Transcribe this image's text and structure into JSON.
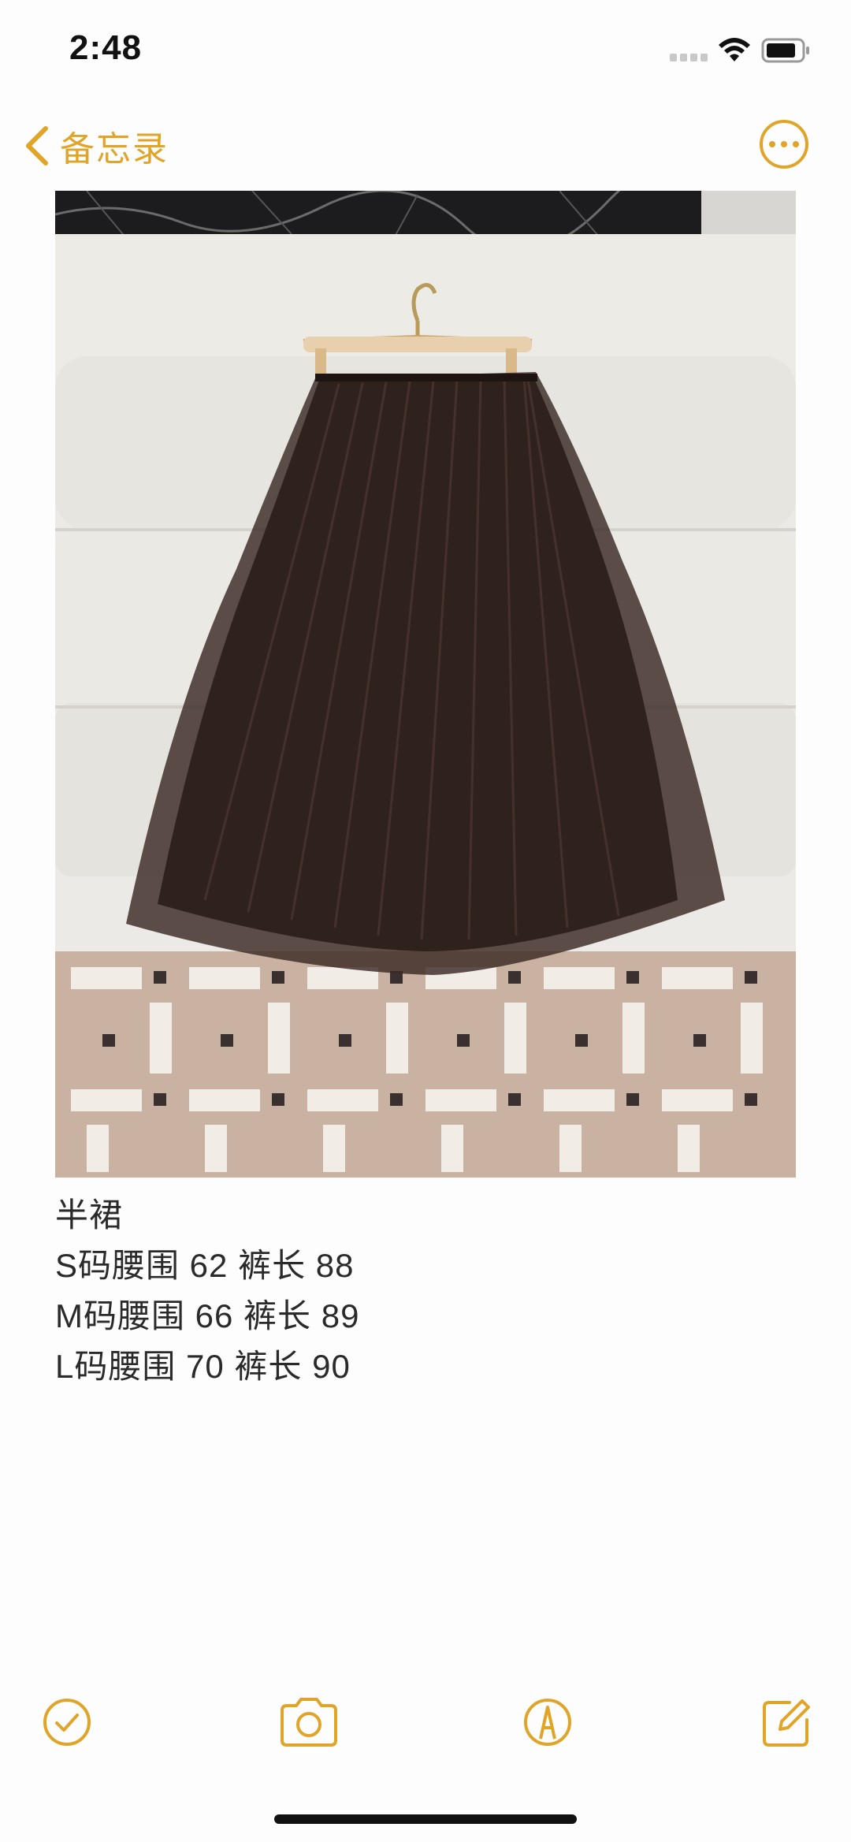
{
  "status_bar": {
    "time": "2:48",
    "icons": [
      "signal-icon",
      "wifi-icon",
      "battery-icon"
    ]
  },
  "nav": {
    "back_label": "备忘录",
    "back_icon": "chevron-left-icon",
    "more_icon": "ellipsis-circle-icon"
  },
  "note": {
    "image_alt": "pleated brown tulle skirt on hanger",
    "lines": [
      "半裙",
      "S码腰围 62 裤长 88",
      "M码腰围 66 裤长 89",
      "L码腰围 70 裤长 90"
    ]
  },
  "toolbar": {
    "items": [
      "checklist-icon",
      "camera-icon",
      "markup-icon",
      "compose-icon"
    ]
  },
  "colors": {
    "accent": "#e0a528",
    "background": "#fdfdfd",
    "text": "#2a2a2a"
  }
}
